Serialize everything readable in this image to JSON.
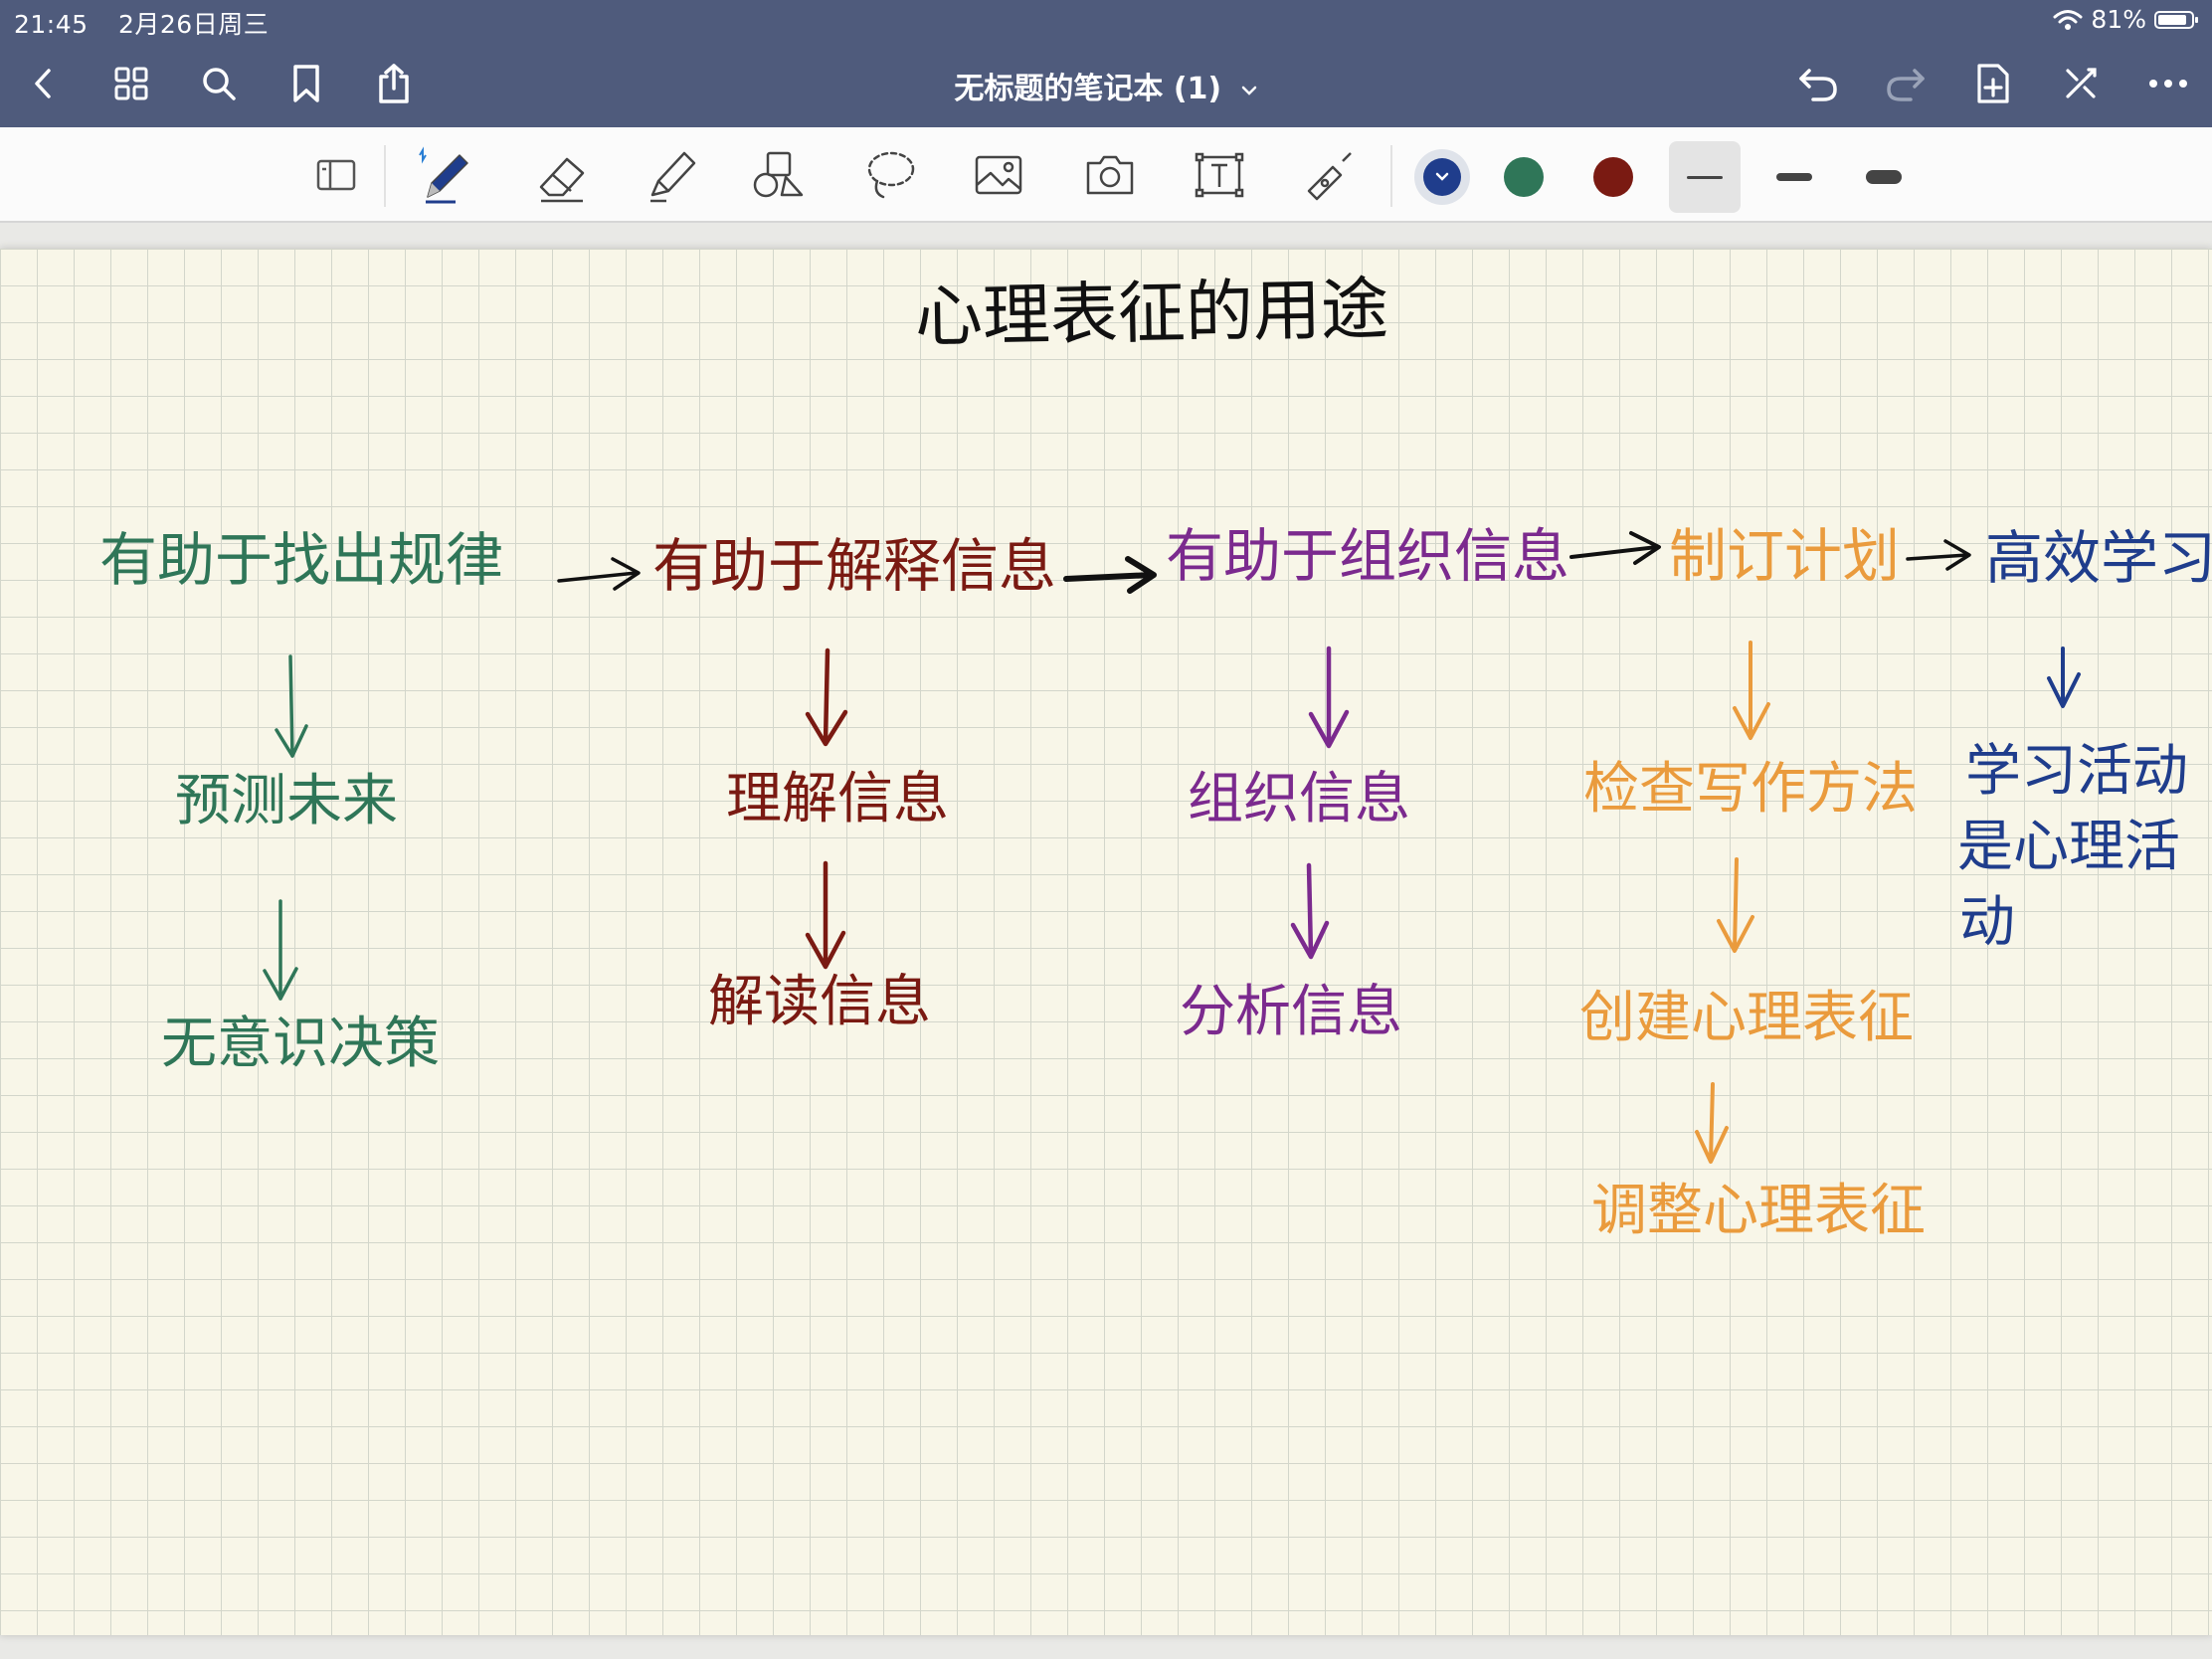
{
  "status_bar": {
    "time": "21:45",
    "date": "2月26日周三",
    "battery": "81%",
    "battery_level": 0.81
  },
  "nav": {
    "title": "无标题的笔记本 (1)",
    "left_icons": [
      "back-chevron-icon",
      "grid-icon",
      "search-icon",
      "bookmark-icon",
      "share-icon"
    ],
    "right_icons": [
      "undo-icon",
      "redo-icon",
      "add-page-icon",
      "close-cross-icon",
      "more-icon"
    ]
  },
  "toolbar": {
    "tools": [
      "read-mode-icon",
      "pen-icon",
      "eraser-icon",
      "highlighter-icon",
      "shapes-icon",
      "lasso-icon",
      "image-icon",
      "camera-icon",
      "text-box-icon",
      "laser-pointer-icon"
    ],
    "selected_tool": "pen-icon",
    "colors": [
      "#1f3d8c",
      "#2f7658",
      "#7a1a12"
    ],
    "selected_color": "#1f3d8c",
    "stroke_widths": [
      "thin",
      "medium",
      "thick"
    ],
    "selected_stroke": "thin"
  },
  "note": {
    "title": "心理表征的用途",
    "green": {
      "top": "有助于找出规律",
      "mid": "预测未来",
      "bottom": "无意识决策",
      "color": "#2f7658"
    },
    "maroon": {
      "top": "有助于解释信息",
      "mid": "理解信息",
      "bottom": "解读信息",
      "color": "#7a1a12"
    },
    "purple": {
      "top": "有助于组织信息",
      "mid": "组织信息",
      "bottom": "分析信息",
      "color": "#7b2a8e"
    },
    "orange": {
      "top": "制订计划",
      "mid": "检查写作方法",
      "bottom": "创建心理表征",
      "last": "调整心理表征",
      "color": "#ea9b3d"
    },
    "navy": {
      "top": "高效学习",
      "line1": "学习活动",
      "line2": "是心理活",
      "line3": "动",
      "color": "#1f3d8c"
    }
  }
}
